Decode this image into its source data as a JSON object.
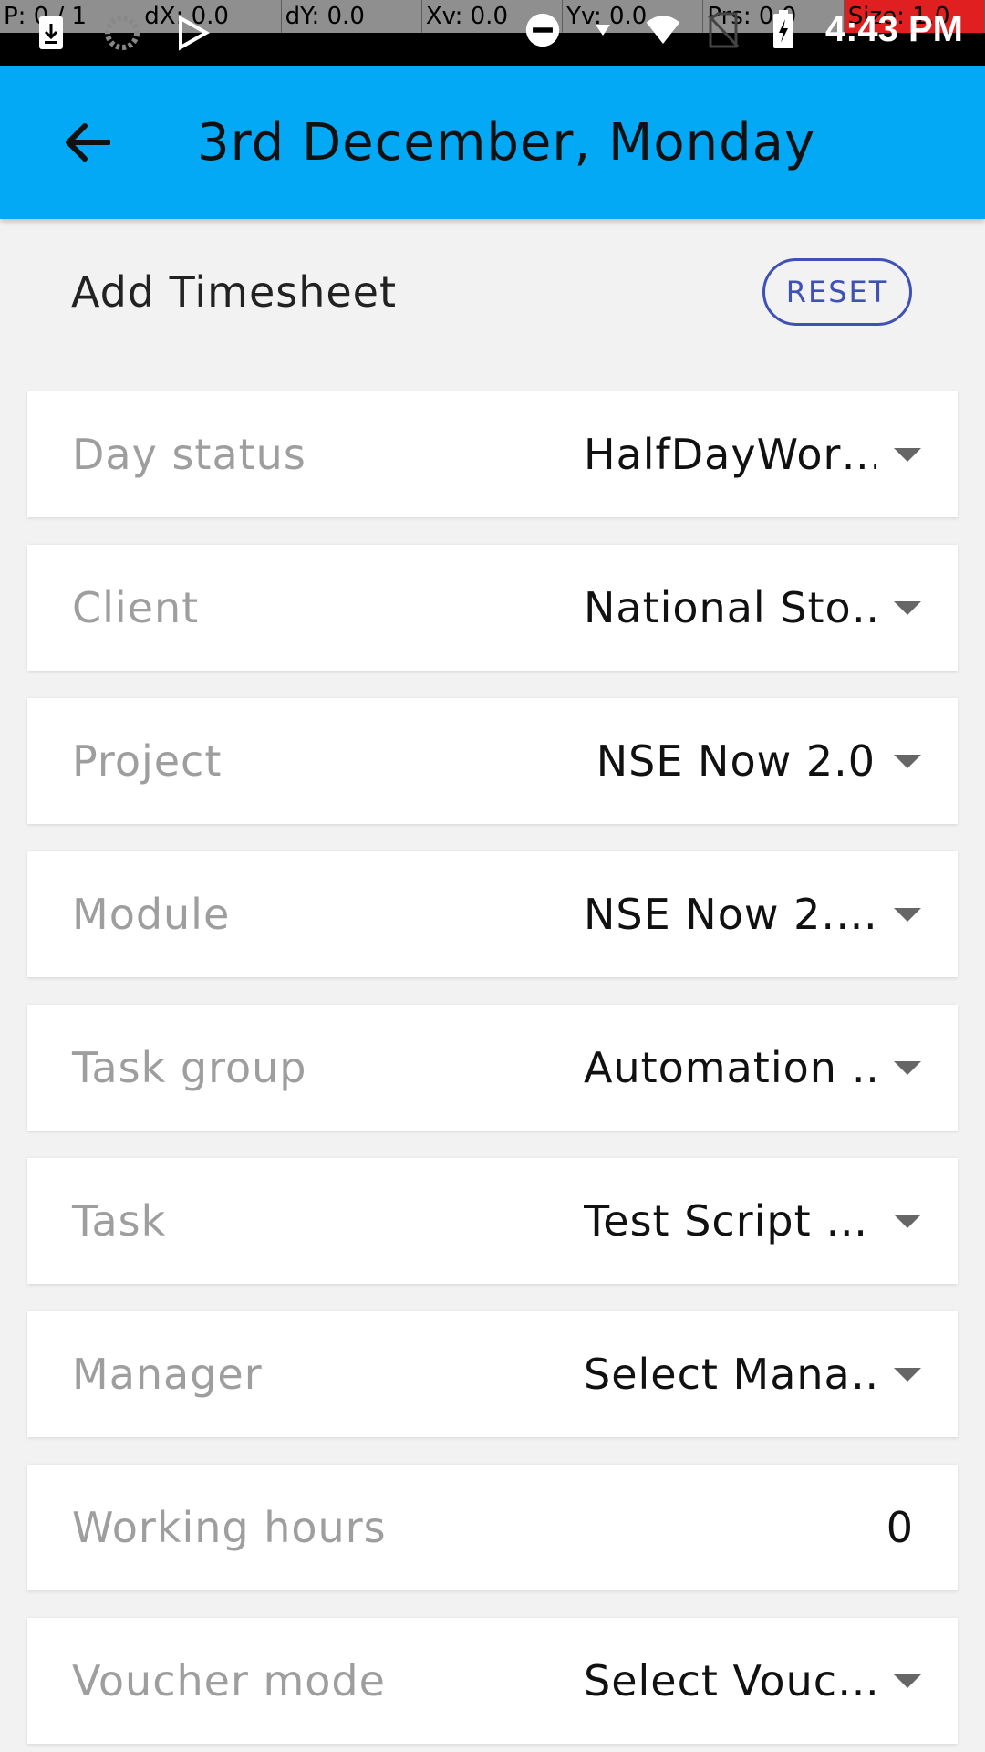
{
  "debug": {
    "cells": [
      "P: 0 / 1",
      "dX: 0.0",
      "dY: 0.0",
      "Xv: 0.0",
      "Yv: 0.0",
      "Prs: 0.0",
      "Size: 1.0"
    ]
  },
  "status_bar": {
    "time": "4:43 PM",
    "icons_left": [
      "download-icon",
      "loading-icon",
      "play-store-icon"
    ],
    "icons_right": [
      "dnd-icon",
      "wifi-icon",
      "no-sim-icon",
      "battery-charging-icon"
    ]
  },
  "app_bar": {
    "title": "3rd December, Monday",
    "background": "#03a9f4"
  },
  "header": {
    "title": "Add Timesheet",
    "reset_label": "RESET",
    "accent": "#3f51b5"
  },
  "fields": [
    {
      "label": "Day status",
      "value": "HalfDayWor…",
      "type": "dropdown"
    },
    {
      "label": "Client",
      "value": "National Sto…",
      "type": "dropdown"
    },
    {
      "label": "Project",
      "value": "NSE Now 2.0",
      "type": "dropdown"
    },
    {
      "label": "Module",
      "value": "NSE Now 2.…",
      "type": "dropdown"
    },
    {
      "label": "Task group",
      "value": "Automation …",
      "type": "dropdown"
    },
    {
      "label": "Task",
      "value": "Test Script …",
      "type": "dropdown"
    },
    {
      "label": "Manager",
      "value": "Select Mana…",
      "type": "dropdown"
    },
    {
      "label": "Working hours",
      "value": "0",
      "type": "number"
    },
    {
      "label": "Voucher mode",
      "value": "Select Vouc…",
      "type": "dropdown"
    }
  ]
}
